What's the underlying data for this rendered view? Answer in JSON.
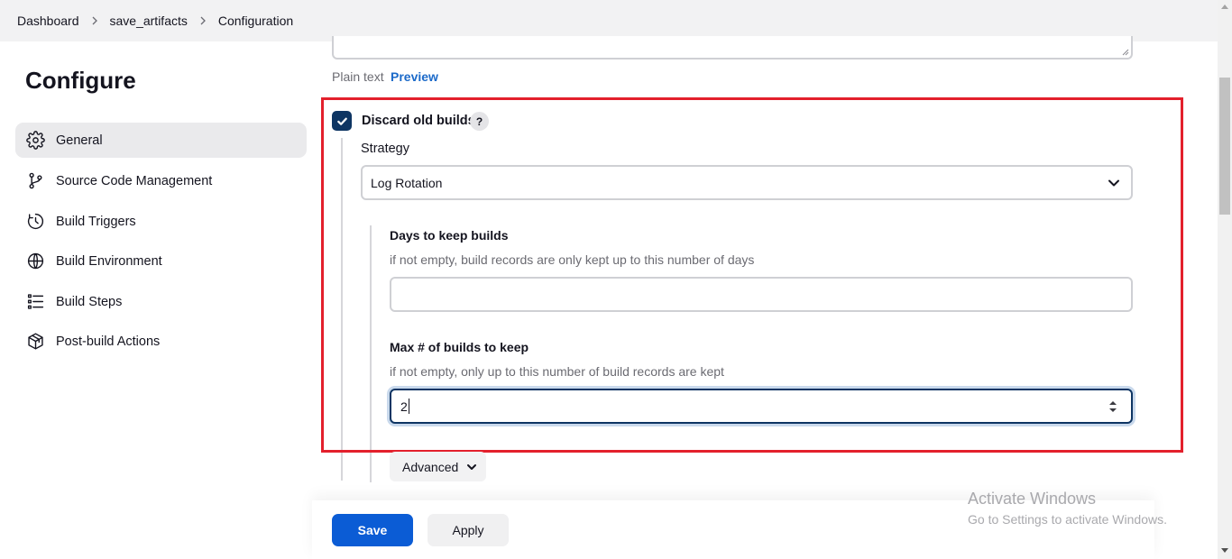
{
  "breadcrumb": {
    "items": [
      "Dashboard",
      "save_artifacts",
      "Configuration"
    ]
  },
  "sidebar": {
    "title": "Configure",
    "items": [
      {
        "label": "General",
        "icon": "gear-icon",
        "active": true
      },
      {
        "label": "Source Code Management",
        "icon": "branch-icon",
        "active": false
      },
      {
        "label": "Build Triggers",
        "icon": "clock-icon",
        "active": false
      },
      {
        "label": "Build Environment",
        "icon": "globe-icon",
        "active": false
      },
      {
        "label": "Build Steps",
        "icon": "list-icon",
        "active": false
      },
      {
        "label": "Post-build Actions",
        "icon": "package-icon",
        "active": false
      }
    ]
  },
  "description": {
    "plain_text_label": "Plain text",
    "preview_label": "Preview"
  },
  "discard": {
    "checkbox_label": "Discard old builds",
    "checked": true,
    "help_label": "?",
    "strategy_label": "Strategy",
    "strategy_value": "Log Rotation",
    "days": {
      "label": "Days to keep builds",
      "description": "if not empty, build records are only kept up to this number of days",
      "value": ""
    },
    "max_builds": {
      "label": "Max # of builds to keep",
      "description": "if not empty, only up to this number of build records are kept",
      "value": "2"
    },
    "advanced_label": "Advanced"
  },
  "actions": {
    "save_label": "Save",
    "apply_label": "Apply"
  },
  "watermark": {
    "title": "Activate Windows",
    "subtitle": "Go to Settings to activate Windows."
  },
  "colors": {
    "accent": "#0b5cd5",
    "checkbox": "#0e3563",
    "highlight": "#e3202c",
    "link": "#1c6ac9"
  }
}
